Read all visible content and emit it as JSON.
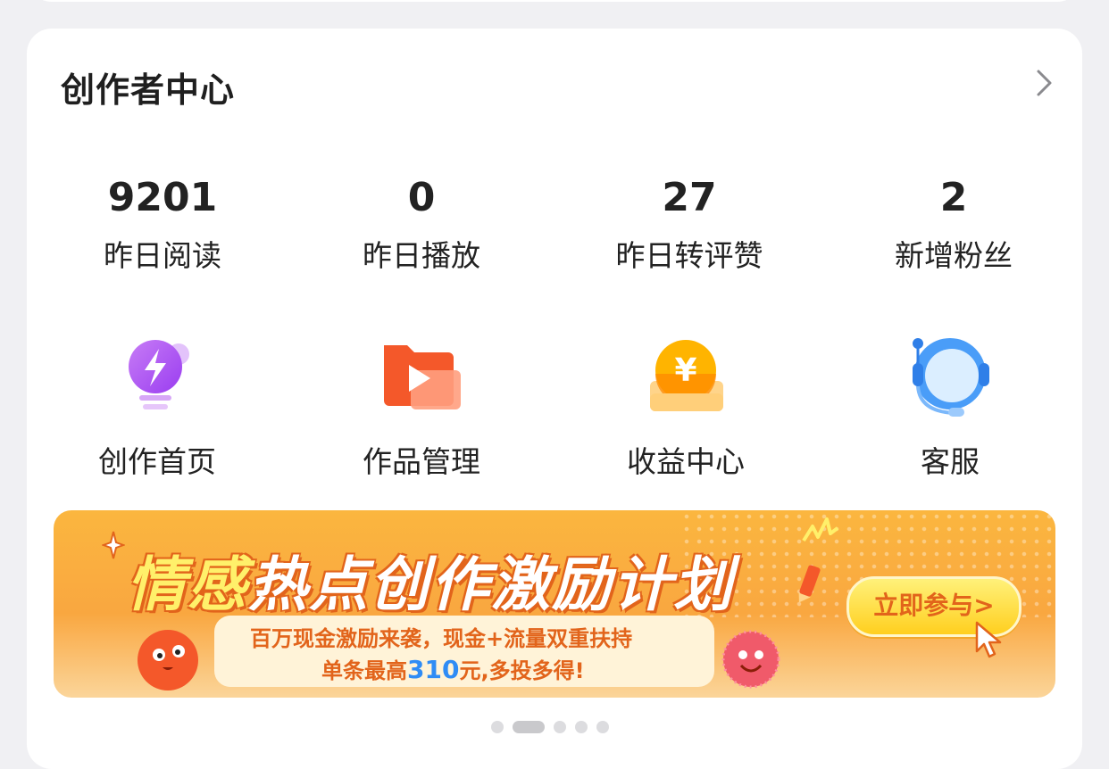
{
  "header": {
    "title": "创作者中心"
  },
  "stats": [
    {
      "value": "9201",
      "label": "昨日阅读"
    },
    {
      "value": "0",
      "label": "昨日播放"
    },
    {
      "value": "27",
      "label": "昨日转评赞"
    },
    {
      "value": "2",
      "label": "新增粉丝"
    }
  ],
  "tools": [
    {
      "label": "创作首页",
      "icon": "lightbulb-bolt-icon"
    },
    {
      "label": "作品管理",
      "icon": "folder-play-icon"
    },
    {
      "label": "收益中心",
      "icon": "yuan-coin-icon"
    },
    {
      "label": "客服",
      "icon": "headset-icon"
    }
  ],
  "banner": {
    "headline_1": "情感",
    "headline_2": "热点创作激励计划",
    "subline_1": "百万现金激励来袭，现金+流量双重扶持",
    "subline_2_prefix": "单条最高",
    "subline_2_amount": "310",
    "subline_2_suffix": "元,多投多得!",
    "cta": "立即参与>"
  },
  "pager": {
    "count": 5,
    "active_index": 1
  },
  "colors": {
    "background": "#f0f0f3",
    "card": "#ffffff",
    "banner_orange": "#f9a740",
    "accent_orange": "#e2641b",
    "accent_blue": "#2f8cf5"
  }
}
